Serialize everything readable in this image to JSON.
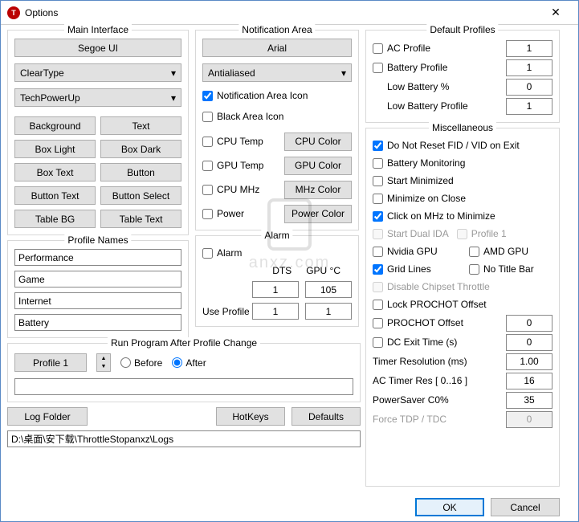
{
  "window": {
    "title": "Options"
  },
  "main_interface": {
    "title": "Main Interface",
    "font_btn": "Segoe UI",
    "render_sel": "ClearType",
    "theme_sel": "TechPowerUp",
    "buttons": [
      "Background",
      "Text",
      "Box Light",
      "Box Dark",
      "Box Text",
      "Button",
      "Button Text",
      "Button Select",
      "Table BG",
      "Table Text"
    ]
  },
  "profile_names": {
    "title": "Profile Names",
    "values": [
      "Performance",
      "Game",
      "Internet",
      "Battery"
    ]
  },
  "notification": {
    "title": "Notification Area",
    "font_btn": "Arial",
    "render_sel": "Antialiased",
    "checks": [
      {
        "label": "Notification Area Icon",
        "checked": true,
        "btn": null
      },
      {
        "label": "Black Area Icon",
        "checked": false,
        "btn": null
      },
      {
        "label": "CPU Temp",
        "checked": false,
        "btn": "CPU Color"
      },
      {
        "label": "GPU Temp",
        "checked": false,
        "btn": "GPU Color"
      },
      {
        "label": "CPU MHz",
        "checked": false,
        "btn": "MHz Color"
      },
      {
        "label": "Power",
        "checked": false,
        "btn": "Power Color"
      }
    ]
  },
  "alarm": {
    "title": "Alarm",
    "chk": "Alarm",
    "h1": "DTS",
    "h2": "GPU °C",
    "v1": "1",
    "v2": "105",
    "use_label": "Use Profile",
    "u1": "1",
    "u2": "1"
  },
  "run_after": {
    "title": "Run Program After Profile Change",
    "profile_sel": "Profile 1",
    "before": "Before",
    "after": "After",
    "path": ""
  },
  "bottom": {
    "log_folder": "Log Folder",
    "hotkeys": "HotKeys",
    "defaults": "Defaults",
    "path": "D:\\桌面\\安下载\\ThrottleStopanxz\\Logs"
  },
  "default_profiles": {
    "title": "Default Profiles",
    "rows": [
      {
        "label": "AC Profile",
        "val": "1",
        "chk": true
      },
      {
        "label": "Battery Profile",
        "val": "1",
        "chk": true
      },
      {
        "label": "Low Battery %",
        "val": "0",
        "chk": false
      },
      {
        "label": "Low Battery Profile",
        "val": "1",
        "chk": false
      }
    ]
  },
  "misc": {
    "title": "Miscellaneous",
    "c1": {
      "label": "Do Not Reset FID / VID on Exit",
      "checked": true
    },
    "c2": {
      "label": "Battery Monitoring",
      "checked": false
    },
    "c3": {
      "label": "Start Minimized",
      "checked": false
    },
    "c4": {
      "label": "Minimize on Close",
      "checked": false
    },
    "c5": {
      "label": "Click on MHz to Minimize",
      "checked": true
    },
    "c6": {
      "label": "Start Dual IDA",
      "checked": false,
      "disabled": true
    },
    "c6b": {
      "label": "Profile 1",
      "checked": false,
      "disabled": true
    },
    "c7": {
      "label": "Nvidia GPU",
      "checked": false
    },
    "c7b": {
      "label": "AMD GPU",
      "checked": false
    },
    "c8": {
      "label": "Grid Lines",
      "checked": true
    },
    "c8b": {
      "label": "No Title Bar",
      "checked": false
    },
    "c9": {
      "label": "Disable Chipset Throttle",
      "checked": false,
      "disabled": true
    },
    "c10": {
      "label": "Lock PROCHOT Offset",
      "checked": false
    },
    "n1": {
      "label": "PROCHOT Offset",
      "val": "0",
      "chk": true
    },
    "n2": {
      "label": "DC Exit Time (s)",
      "val": "0",
      "chk": true
    },
    "n3": {
      "label": "Timer Resolution (ms)",
      "val": "1.00"
    },
    "n4": {
      "label": "AC Timer Res [ 0..16 ]",
      "val": "16"
    },
    "n5": {
      "label": "PowerSaver C0%",
      "val": "35"
    },
    "n6": {
      "label": "Force TDP / TDC",
      "val": "0",
      "disabled": true
    }
  },
  "footer": {
    "ok": "OK",
    "cancel": "Cancel"
  }
}
